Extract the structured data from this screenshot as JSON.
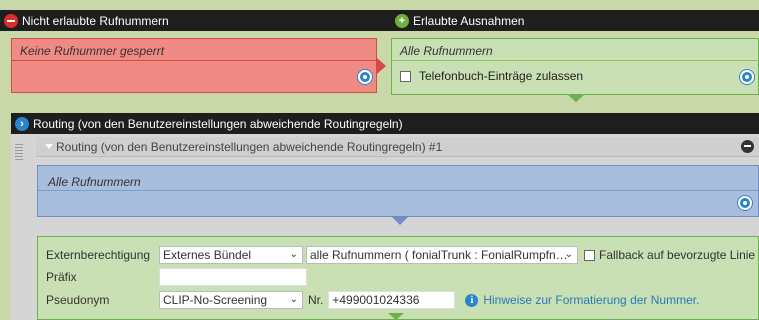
{
  "top_bar": {
    "blocked_title": "Nicht erlaubte Rufnummern",
    "allowed_title": "Erlaubte Ausnahmen"
  },
  "blocked_panel": {
    "text": "Keine Rufnummer gesperrt"
  },
  "allowed_panel": {
    "text": "Alle Rufnummern",
    "phonebook_checkbox_label": "Telefonbuch-Einträge zulassen",
    "phonebook_checked": false
  },
  "routing": {
    "title": "Routing (von den Benutzereinstellungen abweichende Routingregeln)",
    "rule_title": "Routing (von den Benutzereinstellungen abweichende Routingregeln) #1",
    "scope_text": "Alle Rufnummern",
    "form": {
      "external_label": "Externberechtigung",
      "external_value": "Externes Bündel",
      "trunk_value": "alle Rufnummern ( fonialTrunk : FonialRumpfn…",
      "fallback_label": "Fallback auf bevorzugte Linie",
      "fallback_checked": false,
      "prefix_label": "Präfix",
      "prefix_value": "",
      "pseudonym_label": "Pseudonym",
      "pseudonym_value": "CLIP-No-Screening",
      "nr_label": "Nr.",
      "nr_value": "+499001024336",
      "hint_link": "Hinweise zur Formatierung der Nummer."
    }
  },
  "colors": {
    "blocked_bg": "#f08a85",
    "allowed_bg": "#c9e0b4",
    "scope_bg": "#a9bedd",
    "header_bg": "#1e1e1e",
    "accent": "#2a86c8"
  }
}
